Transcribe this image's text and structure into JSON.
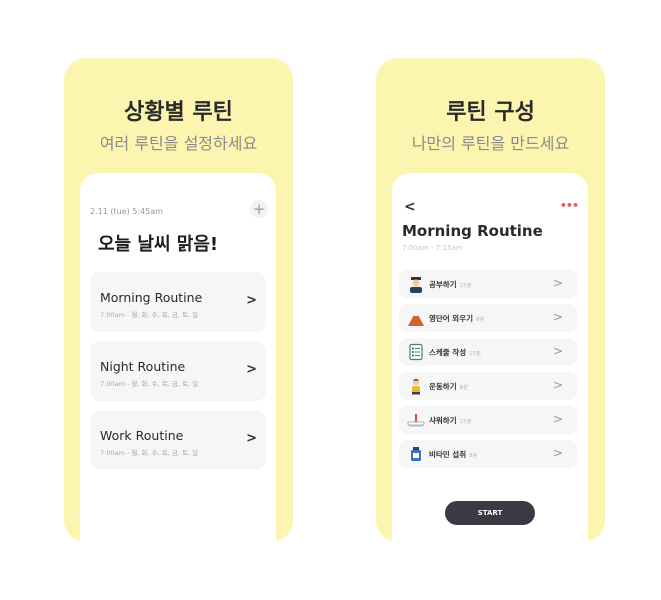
{
  "left_panel": {
    "title": "상황별 루틴",
    "subtitle": "여러 루틴을 설정하세요",
    "date": "2.11 (tue) 5:45am",
    "add_icon": "plus-icon",
    "add_label": "+",
    "greeting": "오늘 날씨 맑음!",
    "routines": [
      {
        "name": "Morning Routine",
        "time": "7:00am - 월, 화, 수, 목, 금, 토, 일",
        "arrow": ">"
      },
      {
        "name": "Night Routine",
        "time": "7:00am - 월, 화, 수, 목, 금, 토, 일",
        "arrow": ">"
      },
      {
        "name": "Work Routine",
        "time": "7:00am - 월, 화, 수, 목, 금, 토, 일",
        "arrow": ">"
      }
    ]
  },
  "right_panel": {
    "title": "루틴 구성",
    "subtitle": "나만의 루틴을 만드세요",
    "back_label": "<",
    "more_label": "•••",
    "routine_title": "Morning Routine",
    "routine_time": "7:00am - 7:15am",
    "tasks": [
      {
        "name": "공부하기",
        "duration": "15분",
        "icon": "student-icon",
        "arrow": ">"
      },
      {
        "name": "영단어 외우기",
        "duration": "8분",
        "icon": "mountain-icon",
        "arrow": ">"
      },
      {
        "name": "스케줄 작성",
        "duration": "15분",
        "icon": "checklist-icon",
        "arrow": ">"
      },
      {
        "name": "운동하기",
        "duration": "8분",
        "icon": "exercise-person-icon",
        "arrow": ">"
      },
      {
        "name": "샤워하기",
        "duration": "15분",
        "icon": "shower-icon",
        "arrow": ">"
      },
      {
        "name": "비타민 섭취",
        "duration": "8분",
        "icon": "vitamin-bottle-icon",
        "arrow": ">"
      }
    ],
    "start_label": "START"
  },
  "colors": {
    "panel_bg": "#fcf5b0",
    "start_button": "#3a3a44",
    "more_dots": "#e35a5a"
  }
}
